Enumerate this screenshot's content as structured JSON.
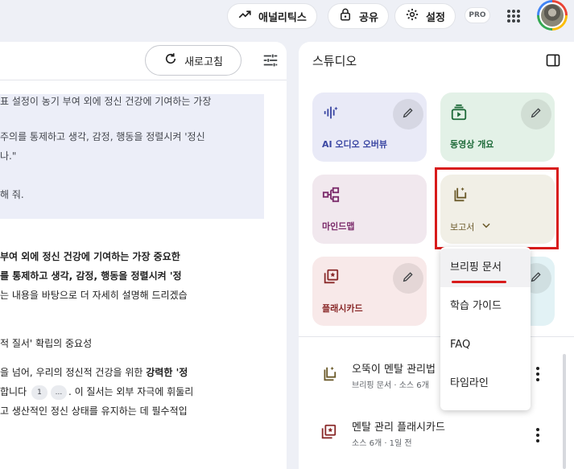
{
  "topbar": {
    "analytics_label": "애널리틱스",
    "share_label": "공유",
    "settings_label": "설정",
    "pro_badge": "PRO"
  },
  "chat": {
    "refresh_label": "새로고침",
    "quote_lines": [
      "표 설정이 농기 부여 외에 정신 건강에 기여하는 가장",
      "주의를 통제하고 생각, 감정, 행동을 정렬시켜 '정신",
      "나.\"",
      "해 줘."
    ],
    "answer": {
      "line1": "부여 외에 정신 건강에 기여하는 가장 중요한",
      "line2": "를 통제하고 생각, 감정, 행동을 정렬시켜 '정",
      "line3": "는 내용을 바탕으로 더 자세히 설명해 드리겠습",
      "line4": "적 질서' 확립의 중요성",
      "line5_pre": "을 넘어, 우리의 정신적 건강을 위한 ",
      "line5_bold": "강력한 '정",
      "line6_pre": "합니다 ",
      "cite1": "1",
      "cite2": "...",
      "line6_post": ". 이 질서는 외부 자극에 휘둘리",
      "line7": "고 생산적인 정신 상태를 유지하는 데 필수적입"
    }
  },
  "studio": {
    "title": "스튜디오",
    "cards": {
      "audio": "AI 오디오 오버뷰",
      "video": "동영상 개요",
      "mindmap": "마인드맵",
      "report": "보고서",
      "flashcards": "플래시카드"
    },
    "notes": [
      {
        "title": "오뚝이 멘탈 관리법",
        "meta": "브리핑 문서 · 소스 6개"
      },
      {
        "title": "멘탈 관리 플래시카드",
        "meta": "소스 6개 · 1일 전"
      }
    ]
  },
  "report_menu": {
    "items": [
      "브리핑 문서",
      "학습 가이드",
      "FAQ",
      "타임라인"
    ]
  },
  "colors": {
    "audio_card": "#e9eaf7",
    "video_card": "#e3f1e7",
    "mindmap_card": "#f1e8ee",
    "report_card": "#f1efe6",
    "flashcards_card": "#f8e9e9",
    "highlight": "#d81b1b"
  }
}
